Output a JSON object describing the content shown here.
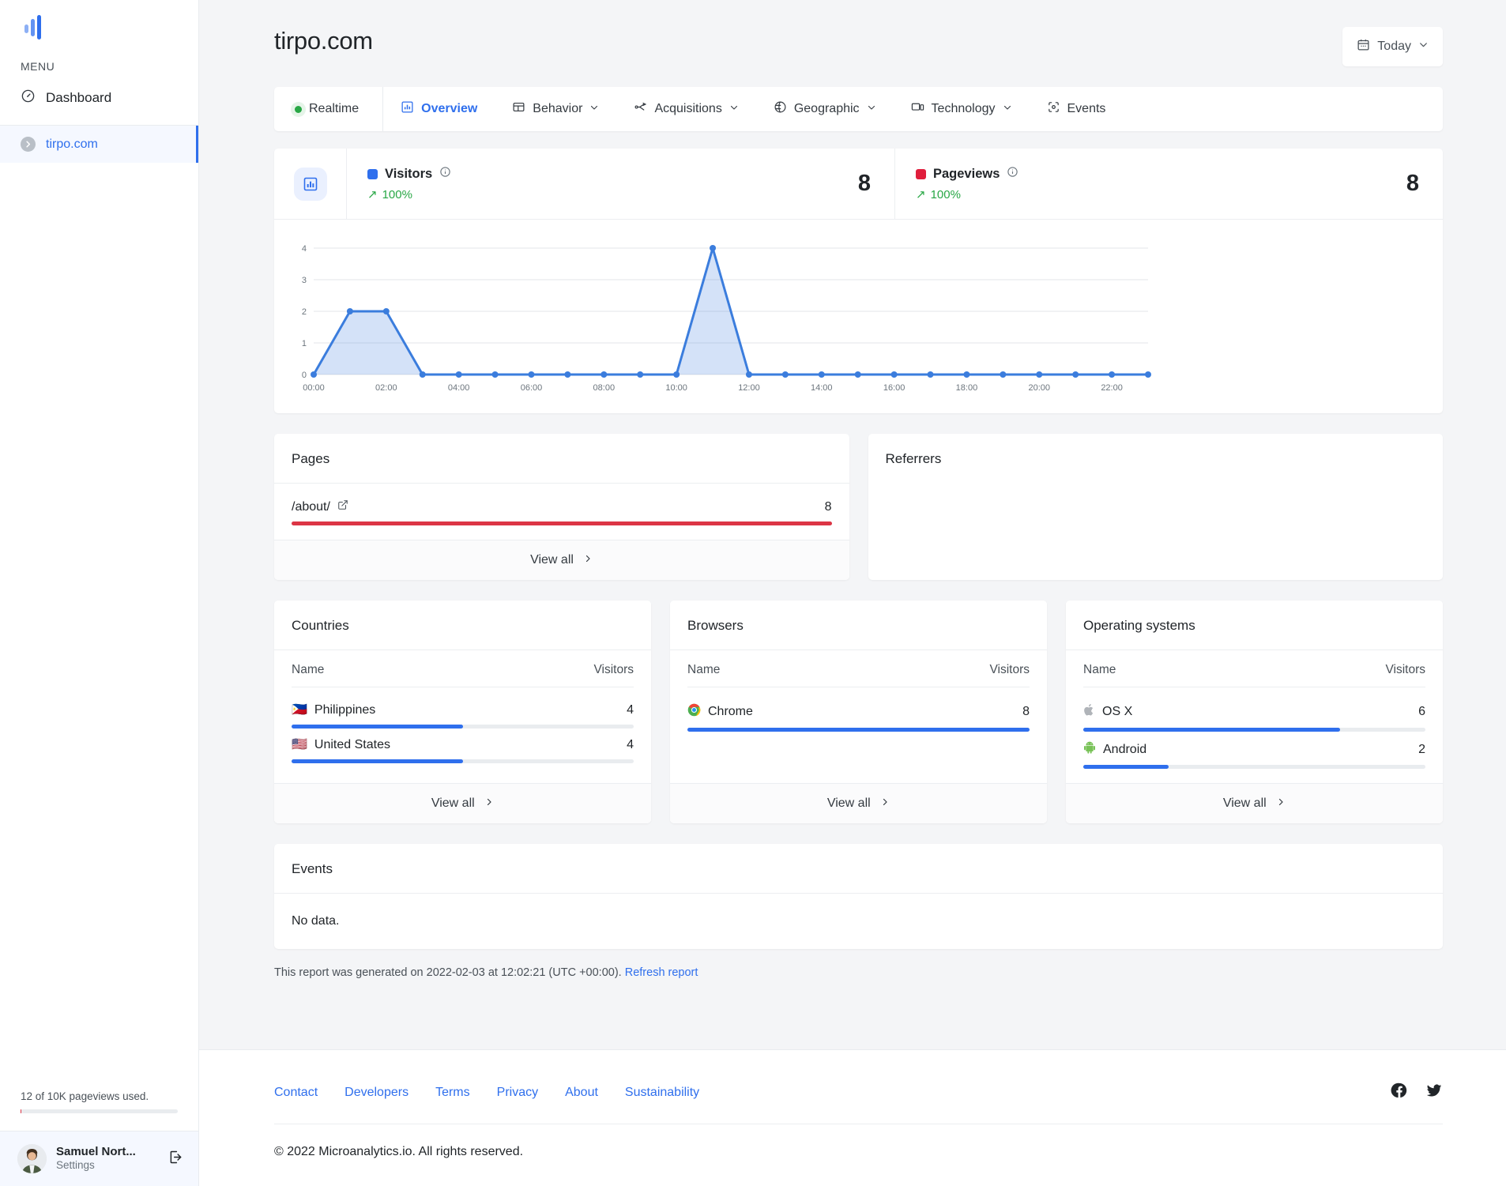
{
  "sidebar": {
    "logo_name": "microanalytics-logo",
    "menu_label": "MENU",
    "items": [
      {
        "label": "Dashboard",
        "icon": "gauge-icon"
      }
    ],
    "sites": [
      {
        "label": "tirpo.com",
        "icon": "chevron-circle-icon"
      }
    ],
    "usage": {
      "text": "12 of 10K pageviews used.",
      "percent": 0.12
    },
    "user": {
      "name": "Samuel Nort...",
      "sub": "Settings",
      "logout_icon": "logout-icon"
    }
  },
  "header": {
    "title": "tirpo.com",
    "date_picker": {
      "label": "Today",
      "icon": "calendar-icon",
      "chevron": "chevron-down-icon"
    }
  },
  "tabs": [
    {
      "label": "Realtime",
      "icon": "green-dot-icon",
      "active": false,
      "caret": ""
    },
    {
      "label": "Overview",
      "icon": "bar-chart-icon",
      "active": true,
      "caret": ""
    },
    {
      "label": "Behavior",
      "icon": "layout-icon",
      "active": false,
      "caret": "⌄"
    },
    {
      "label": "Acquisitions",
      "icon": "share-icon",
      "active": false,
      "caret": "⌄"
    },
    {
      "label": "Geographic",
      "icon": "globe-icon",
      "active": false,
      "caret": "⌄"
    },
    {
      "label": "Technology",
      "icon": "device-icon",
      "active": false,
      "caret": "⌄"
    },
    {
      "label": "Events",
      "icon": "target-icon",
      "active": false,
      "caret": ""
    }
  ],
  "metrics": {
    "panel_icon": "bar-chart-icon",
    "items": [
      {
        "title": "Visitors",
        "color": "#2f6fed",
        "trend": "100%",
        "trend_arrow": "↗",
        "value": "8",
        "info_icon": "info-icon"
      },
      {
        "title": "Pageviews",
        "color": "#e01e3c",
        "trend": "100%",
        "trend_arrow": "↗",
        "value": "8",
        "info_icon": "info-icon"
      }
    ]
  },
  "chart_data": {
    "type": "area",
    "title": "",
    "xlabel": "",
    "ylabel": "",
    "x": [
      "00:00",
      "01:00",
      "02:00",
      "03:00",
      "04:00",
      "05:00",
      "06:00",
      "07:00",
      "08:00",
      "09:00",
      "10:00",
      "11:00",
      "12:00",
      "13:00",
      "14:00",
      "15:00",
      "16:00",
      "17:00",
      "18:00",
      "19:00",
      "20:00",
      "21:00",
      "22:00",
      "23:00"
    ],
    "tick_labels": [
      "00:00",
      "02:00",
      "04:00",
      "06:00",
      "08:00",
      "10:00",
      "12:00",
      "14:00",
      "16:00",
      "18:00",
      "20:00",
      "22:00"
    ],
    "series": [
      {
        "name": "Visitors",
        "color": "#3b7ddd",
        "values": [
          0,
          2,
          2,
          0,
          0,
          0,
          0,
          0,
          0,
          0,
          0,
          4,
          0,
          0,
          0,
          0,
          0,
          0,
          0,
          0,
          0,
          0,
          0,
          0
        ]
      }
    ],
    "yticks": [
      0,
      1,
      2,
      3,
      4
    ],
    "ylim": [
      0,
      4
    ],
    "grid": true,
    "legend": "none"
  },
  "pages_panel": {
    "title": "Pages",
    "rows": [
      {
        "name": "/about/",
        "value": "8",
        "percent": 100,
        "bar_color": "#dc3545",
        "link_icon": "external-link-icon"
      }
    ],
    "view_all": "View all"
  },
  "referrers_panel": {
    "title": "Referrers",
    "rows": []
  },
  "countries_panel": {
    "title": "Countries",
    "col_name": "Name",
    "col_value": "Visitors",
    "rows": [
      {
        "flag": "🇵🇭",
        "name": "Philippines",
        "value": "4",
        "percent": 50
      },
      {
        "flag": "🇺🇸",
        "name": "United States",
        "value": "4",
        "percent": 50
      }
    ],
    "view_all": "View all"
  },
  "browsers_panel": {
    "title": "Browsers",
    "col_name": "Name",
    "col_value": "Visitors",
    "rows": [
      {
        "icon": "chrome-icon",
        "name": "Chrome",
        "value": "8",
        "percent": 100
      }
    ],
    "view_all": "View all"
  },
  "os_panel": {
    "title": "Operating systems",
    "col_name": "Name",
    "col_value": "Visitors",
    "rows": [
      {
        "icon": "apple-icon",
        "name": "OS X",
        "value": "6",
        "percent": 75
      },
      {
        "icon": "android-icon",
        "name": "Android",
        "value": "2",
        "percent": 25
      }
    ],
    "view_all": "View all"
  },
  "events_panel": {
    "title": "Events",
    "empty_text": "No data."
  },
  "report": {
    "text": "This report was generated on 2022-02-03 at 12:02:21 (UTC +00:00).",
    "refresh_label": "Refresh report"
  },
  "footer": {
    "links": [
      "Contact",
      "Developers",
      "Terms",
      "Privacy",
      "About",
      "Sustainability"
    ],
    "socials": [
      "facebook-icon",
      "twitter-icon"
    ],
    "copyright": "© 2022 Microanalytics.io. All rights reserved."
  },
  "colors": {
    "accent": "#2f6fed",
    "chart_line": "#3b7ddd",
    "danger": "#dc3545",
    "success": "#28a745",
    "page_bg": "#f4f5f7"
  }
}
